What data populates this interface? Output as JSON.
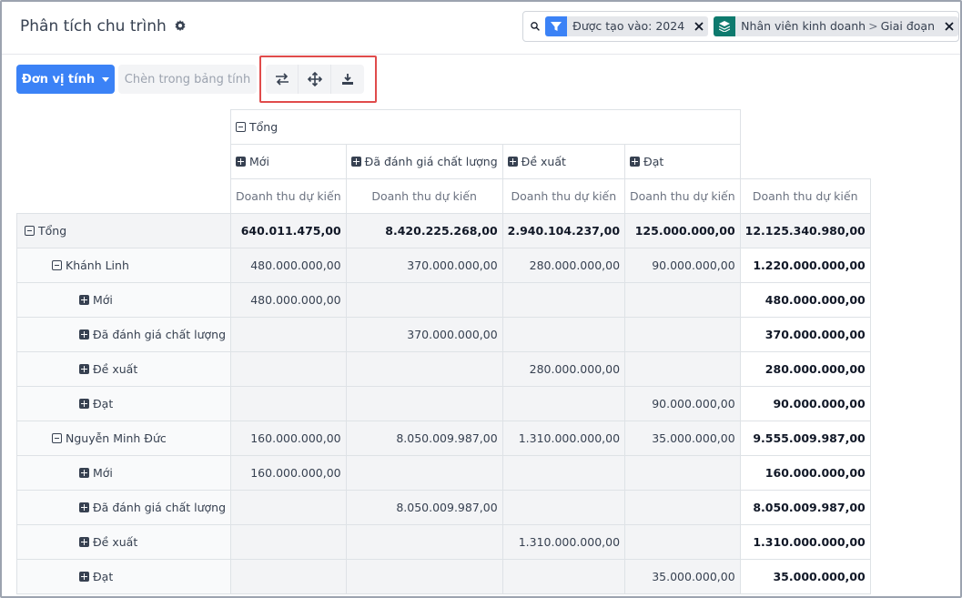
{
  "header": {
    "title": "Phân tích chu trình",
    "facets": [
      {
        "icon": "filter-icon",
        "text": "Được tạo vào: 2024"
      },
      {
        "icon": "layers-icon",
        "parts": [
          "Nhân viên kinh doanh",
          "Giai đoạn"
        ],
        "separator": ">"
      }
    ]
  },
  "toolbar": {
    "measures_label": "Đơn vị tính",
    "insert_label": "Chèn trong bảng tính",
    "icons": [
      "flip-axis-icon",
      "expand-all-icon",
      "download-icon"
    ]
  },
  "colors": {
    "primary": "#3b82f6",
    "teal": "#0e7a6e",
    "highlight": "#e04b4b"
  },
  "pivot": {
    "col_total_label": "Tổng",
    "col_groups": [
      "Mới",
      "Đã đánh giá chất lượng",
      "Đề xuất",
      "Đạt"
    ],
    "measure": "Doanh thu dự kiến",
    "rows": [
      {
        "label": "Tổng",
        "level": 1,
        "toggle": "minus",
        "values": [
          "640.011.475,00",
          "8.420.225.268,00",
          "2.940.104.237,00",
          "125.000.000,00",
          "12.125.340.980,00"
        ]
      },
      {
        "label": "Khánh Linh",
        "level": 2,
        "toggle": "minus",
        "values": [
          "480.000.000,00",
          "370.000.000,00",
          "280.000.000,00",
          "90.000.000,00",
          "1.220.000.000,00"
        ]
      },
      {
        "label": "Mới",
        "level": 3,
        "toggle": "plus",
        "values": [
          "480.000.000,00",
          "",
          "",
          "",
          "480.000.000,00"
        ]
      },
      {
        "label": "Đã đánh giá chất lượng",
        "level": 3,
        "toggle": "plus",
        "values": [
          "",
          "370.000.000,00",
          "",
          "",
          "370.000.000,00"
        ]
      },
      {
        "label": "Đề xuất",
        "level": 3,
        "toggle": "plus",
        "values": [
          "",
          "",
          "280.000.000,00",
          "",
          "280.000.000,00"
        ]
      },
      {
        "label": "Đạt",
        "level": 3,
        "toggle": "plus",
        "values": [
          "",
          "",
          "",
          "90.000.000,00",
          "90.000.000,00"
        ]
      },
      {
        "label": "Nguyễn Minh Đức",
        "level": 2,
        "toggle": "minus",
        "values": [
          "160.000.000,00",
          "8.050.009.987,00",
          "1.310.000.000,00",
          "35.000.000,00",
          "9.555.009.987,00"
        ]
      },
      {
        "label": "Mới",
        "level": 3,
        "toggle": "plus",
        "values": [
          "160.000.000,00",
          "",
          "",
          "",
          "160.000.000,00"
        ]
      },
      {
        "label": "Đã đánh giá chất lượng",
        "level": 3,
        "toggle": "plus",
        "values": [
          "",
          "8.050.009.987,00",
          "",
          "",
          "8.050.009.987,00"
        ]
      },
      {
        "label": "Đề xuất",
        "level": 3,
        "toggle": "plus",
        "values": [
          "",
          "",
          "1.310.000.000,00",
          "",
          "1.310.000.000,00"
        ]
      },
      {
        "label": "Đạt",
        "level": 3,
        "toggle": "plus",
        "values": [
          "",
          "",
          "",
          "35.000.000,00",
          "35.000.000,00"
        ]
      }
    ]
  }
}
